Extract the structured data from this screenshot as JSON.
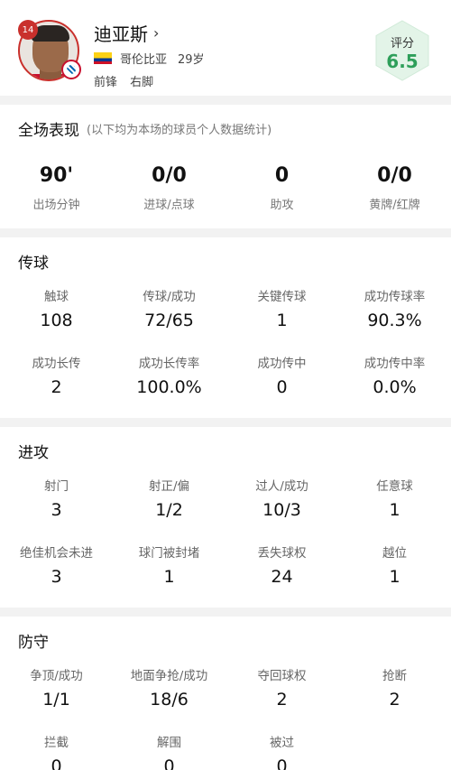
{
  "player": {
    "number": "14",
    "name": "迪亚斯",
    "country": "哥伦比亚",
    "age": "29岁",
    "position": "前锋",
    "foot": "右脚"
  },
  "rating": {
    "label": "评分",
    "value": "6.5",
    "color": "#2e9f5a"
  },
  "overview": {
    "title": "全场表现",
    "note": "(以下均为本场的球员个人数据统计)",
    "stats": [
      {
        "value": "90'",
        "label": "出场分钟"
      },
      {
        "value": "0/0",
        "label": "进球/点球"
      },
      {
        "value": "0",
        "label": "助攻"
      },
      {
        "value": "0/0",
        "label": "黄牌/红牌"
      }
    ]
  },
  "passing": {
    "title": "传球",
    "stats": [
      {
        "label": "触球",
        "value": "108"
      },
      {
        "label": "传球/成功",
        "value": "72/65"
      },
      {
        "label": "关键传球",
        "value": "1"
      },
      {
        "label": "成功传球率",
        "value": "90.3%"
      },
      {
        "label": "成功长传",
        "value": "2"
      },
      {
        "label": "成功长传率",
        "value": "100.0%"
      },
      {
        "label": "成功传中",
        "value": "0"
      },
      {
        "label": "成功传中率",
        "value": "0.0%"
      }
    ]
  },
  "attack": {
    "title": "进攻",
    "stats": [
      {
        "label": "射门",
        "value": "3"
      },
      {
        "label": "射正/偏",
        "value": "1/2"
      },
      {
        "label": "过人/成功",
        "value": "10/3"
      },
      {
        "label": "任意球",
        "value": "1"
      },
      {
        "label": "绝佳机会未进",
        "value": "3"
      },
      {
        "label": "球门被封堵",
        "value": "1"
      },
      {
        "label": "丢失球权",
        "value": "24"
      },
      {
        "label": "越位",
        "value": "1"
      }
    ]
  },
  "defense": {
    "title": "防守",
    "stats": [
      {
        "label": "争顶/成功",
        "value": "1/1"
      },
      {
        "label": "地面争抢/成功",
        "value": "18/6"
      },
      {
        "label": "夺回球权",
        "value": "2"
      },
      {
        "label": "抢断",
        "value": "2"
      },
      {
        "label": "拦截",
        "value": "0"
      },
      {
        "label": "解围",
        "value": "0"
      },
      {
        "label": "被过",
        "value": "0"
      }
    ]
  }
}
